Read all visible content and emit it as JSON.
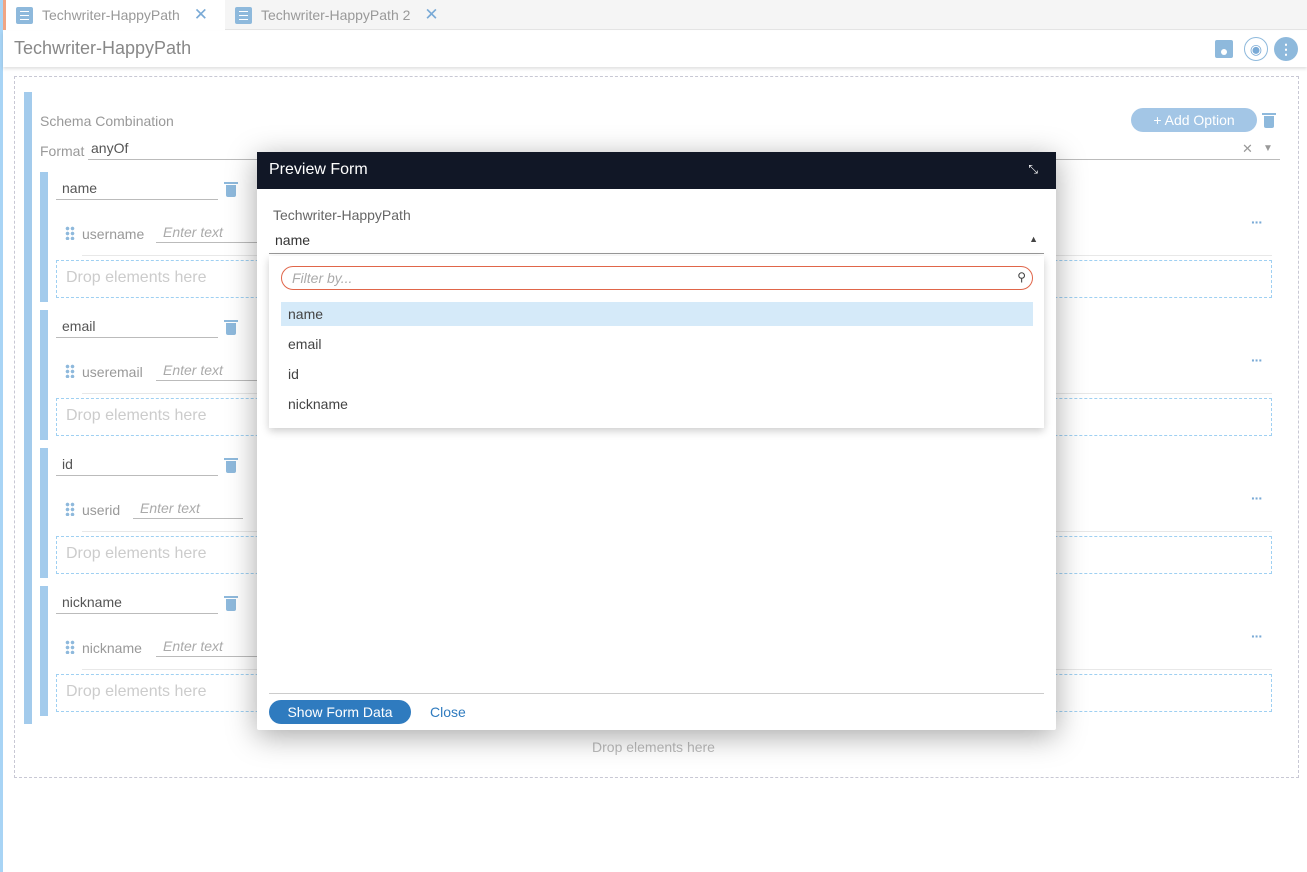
{
  "tabs": [
    {
      "label": "Techwriter-HappyPath",
      "active": true
    },
    {
      "label": "Techwriter-HappyPath 2",
      "active": false
    }
  ],
  "page_title": "Techwriter-HappyPath",
  "schema": {
    "label": "Schema Combination",
    "add_option": "+ Add Option",
    "format_label": "Format",
    "format_value": "anyOf"
  },
  "groups": [
    {
      "name": "name",
      "field": "username",
      "placeholder": "Enter text",
      "drop": "Drop elements here"
    },
    {
      "name": "email",
      "field": "useremail",
      "placeholder": "Enter text",
      "drop": "Drop elements here"
    },
    {
      "name": "id",
      "field": "userid",
      "placeholder": "Enter text",
      "drop": "Drop elements here"
    },
    {
      "name": "nickname",
      "field": "nickname",
      "placeholder": "Enter text",
      "drop": "Drop elements here"
    }
  ],
  "outer_drop": "Drop elements here",
  "modal": {
    "title": "Preview Form",
    "form_label": "Techwriter-HappyPath",
    "selected": "name",
    "filter_placeholder": "Filter by...",
    "options": [
      "name",
      "email",
      "id",
      "nickname"
    ],
    "show_data": "Show Form Data",
    "close": "Close"
  }
}
